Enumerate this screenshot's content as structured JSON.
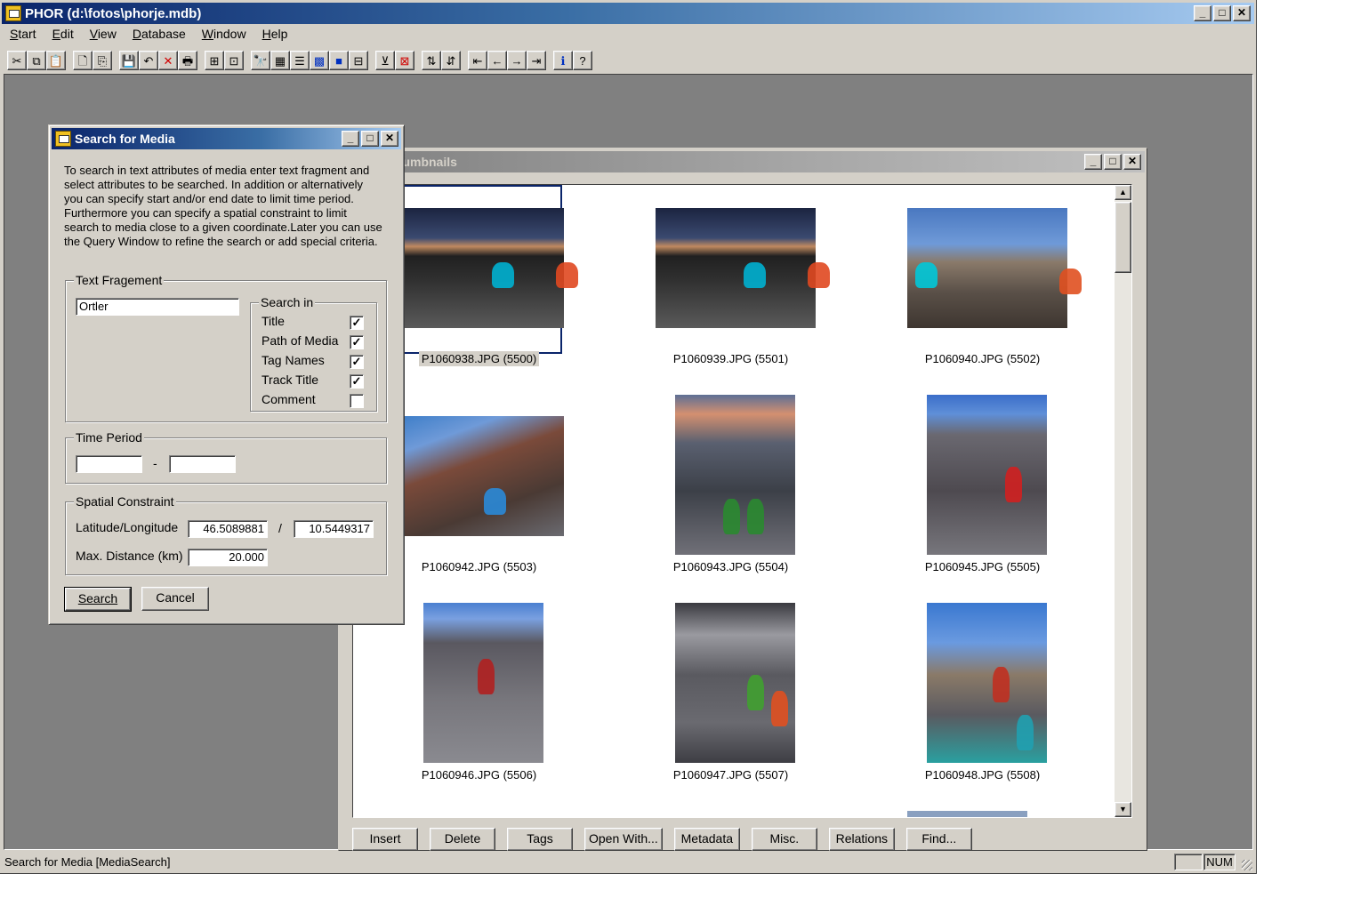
{
  "app": {
    "title": "PHOR (d:\\fotos\\phorje.mdb)",
    "menu": [
      {
        "label": "Start",
        "accel": "S",
        "rest": "tart"
      },
      {
        "label": "Edit",
        "accel": "E",
        "rest": "dit"
      },
      {
        "label": "View",
        "accel": "V",
        "rest": "iew"
      },
      {
        "label": "Database",
        "accel": "D",
        "rest": "atabase"
      },
      {
        "label": "Window",
        "accel": "W",
        "rest": "indow"
      },
      {
        "label": "Help",
        "accel": "H",
        "rest": "elp"
      }
    ],
    "toolbar_icons": [
      "cut-icon",
      "copy-icon",
      "paste-icon",
      "new-icon",
      "duplicate-icon",
      "save-icon",
      "undo-icon",
      "delete-icon",
      "print-icon",
      "insert-media-icon",
      "import-icon",
      "find-icon",
      "grid-icon",
      "details-icon",
      "thumbnails-icon",
      "blue-square-icon",
      "tree-icon",
      "filter-icon",
      "clear-filter-icon",
      "sort-asc-icon",
      "sort-desc-icon",
      "first-record-icon",
      "prev-record-icon",
      "next-record-icon",
      "last-record-icon",
      "info-icon",
      "help-icon"
    ],
    "statusbar": {
      "text": "Search for Media [MediaSearch]",
      "num": "NUM"
    }
  },
  "thumbnails": {
    "title": "Files - Thumbnails",
    "items": [
      {
        "label": "P1060938.JPG (5500)",
        "selected": true,
        "orientation": "land",
        "scene": "night-pair"
      },
      {
        "label": "P1060939.JPG (5501)",
        "selected": false,
        "orientation": "land",
        "scene": "night-pair"
      },
      {
        "label": "P1060940.JPG (5502)",
        "selected": false,
        "orientation": "land",
        "scene": "rock-pair"
      },
      {
        "label": "P1060942.JPG (5503)",
        "selected": false,
        "orientation": "land",
        "scene": "ridge-back"
      },
      {
        "label": "P1060943.JPG (5504)",
        "selected": false,
        "orientation": "port",
        "scene": "dusk-ridge"
      },
      {
        "label": "P1060945.JPG (5505)",
        "selected": false,
        "orientation": "port",
        "scene": "rock-face"
      },
      {
        "label": "P1060946.JPG (5506)",
        "selected": false,
        "orientation": "port",
        "scene": "rock-face-2"
      },
      {
        "label": "P1060947.JPG (5507)",
        "selected": false,
        "orientation": "port",
        "scene": "climber-green"
      },
      {
        "label": "P1060948.JPG (5508)",
        "selected": false,
        "orientation": "port",
        "scene": "pinnacle"
      }
    ],
    "buttons": [
      {
        "name": "insert-button",
        "label": "Insert"
      },
      {
        "name": "delete-button",
        "label": "Delete"
      },
      {
        "name": "tags-button",
        "label": "Tags"
      },
      {
        "name": "open-with-button",
        "label": "Open With..."
      },
      {
        "name": "metadata-button",
        "label": "Metadata"
      },
      {
        "name": "misc-button",
        "label": "Misc."
      },
      {
        "name": "relations-button",
        "label": "Relations"
      },
      {
        "name": "find-button",
        "label": "Find..."
      }
    ]
  },
  "search_dialog": {
    "title": "Search for Media",
    "description": "To search in text attributes of media enter text fragment and select attributes to be searched. In addition or alternatively you can specify start and/or end date to limit time period. Furthermore you can specify a spatial constraint to limit search to media close to a given coordinate.Later you can use the Query Window to refine the search or add special criteria.",
    "text_fragment": {
      "legend": "Text Fragement",
      "value": "Ortler",
      "search_in_legend": "Search in",
      "options": [
        {
          "label": "Title",
          "checked": true
        },
        {
          "label": "Path of Media",
          "checked": true
        },
        {
          "label": "Tag Names",
          "checked": true
        },
        {
          "label": "Track Title",
          "checked": true
        },
        {
          "label": "Comment",
          "checked": false
        }
      ]
    },
    "time_period": {
      "legend": "Time Period",
      "start": "",
      "separator": "-",
      "end": ""
    },
    "spatial": {
      "legend": "Spatial Constraint",
      "latlon_label": "Latitude/Longitude",
      "latitude": "46.5089881",
      "slash": "/",
      "longitude": "10.5449317",
      "distance_label": "Max. Distance (km)",
      "distance": "20.000"
    },
    "search_label": "Search",
    "cancel_label": "Cancel"
  }
}
